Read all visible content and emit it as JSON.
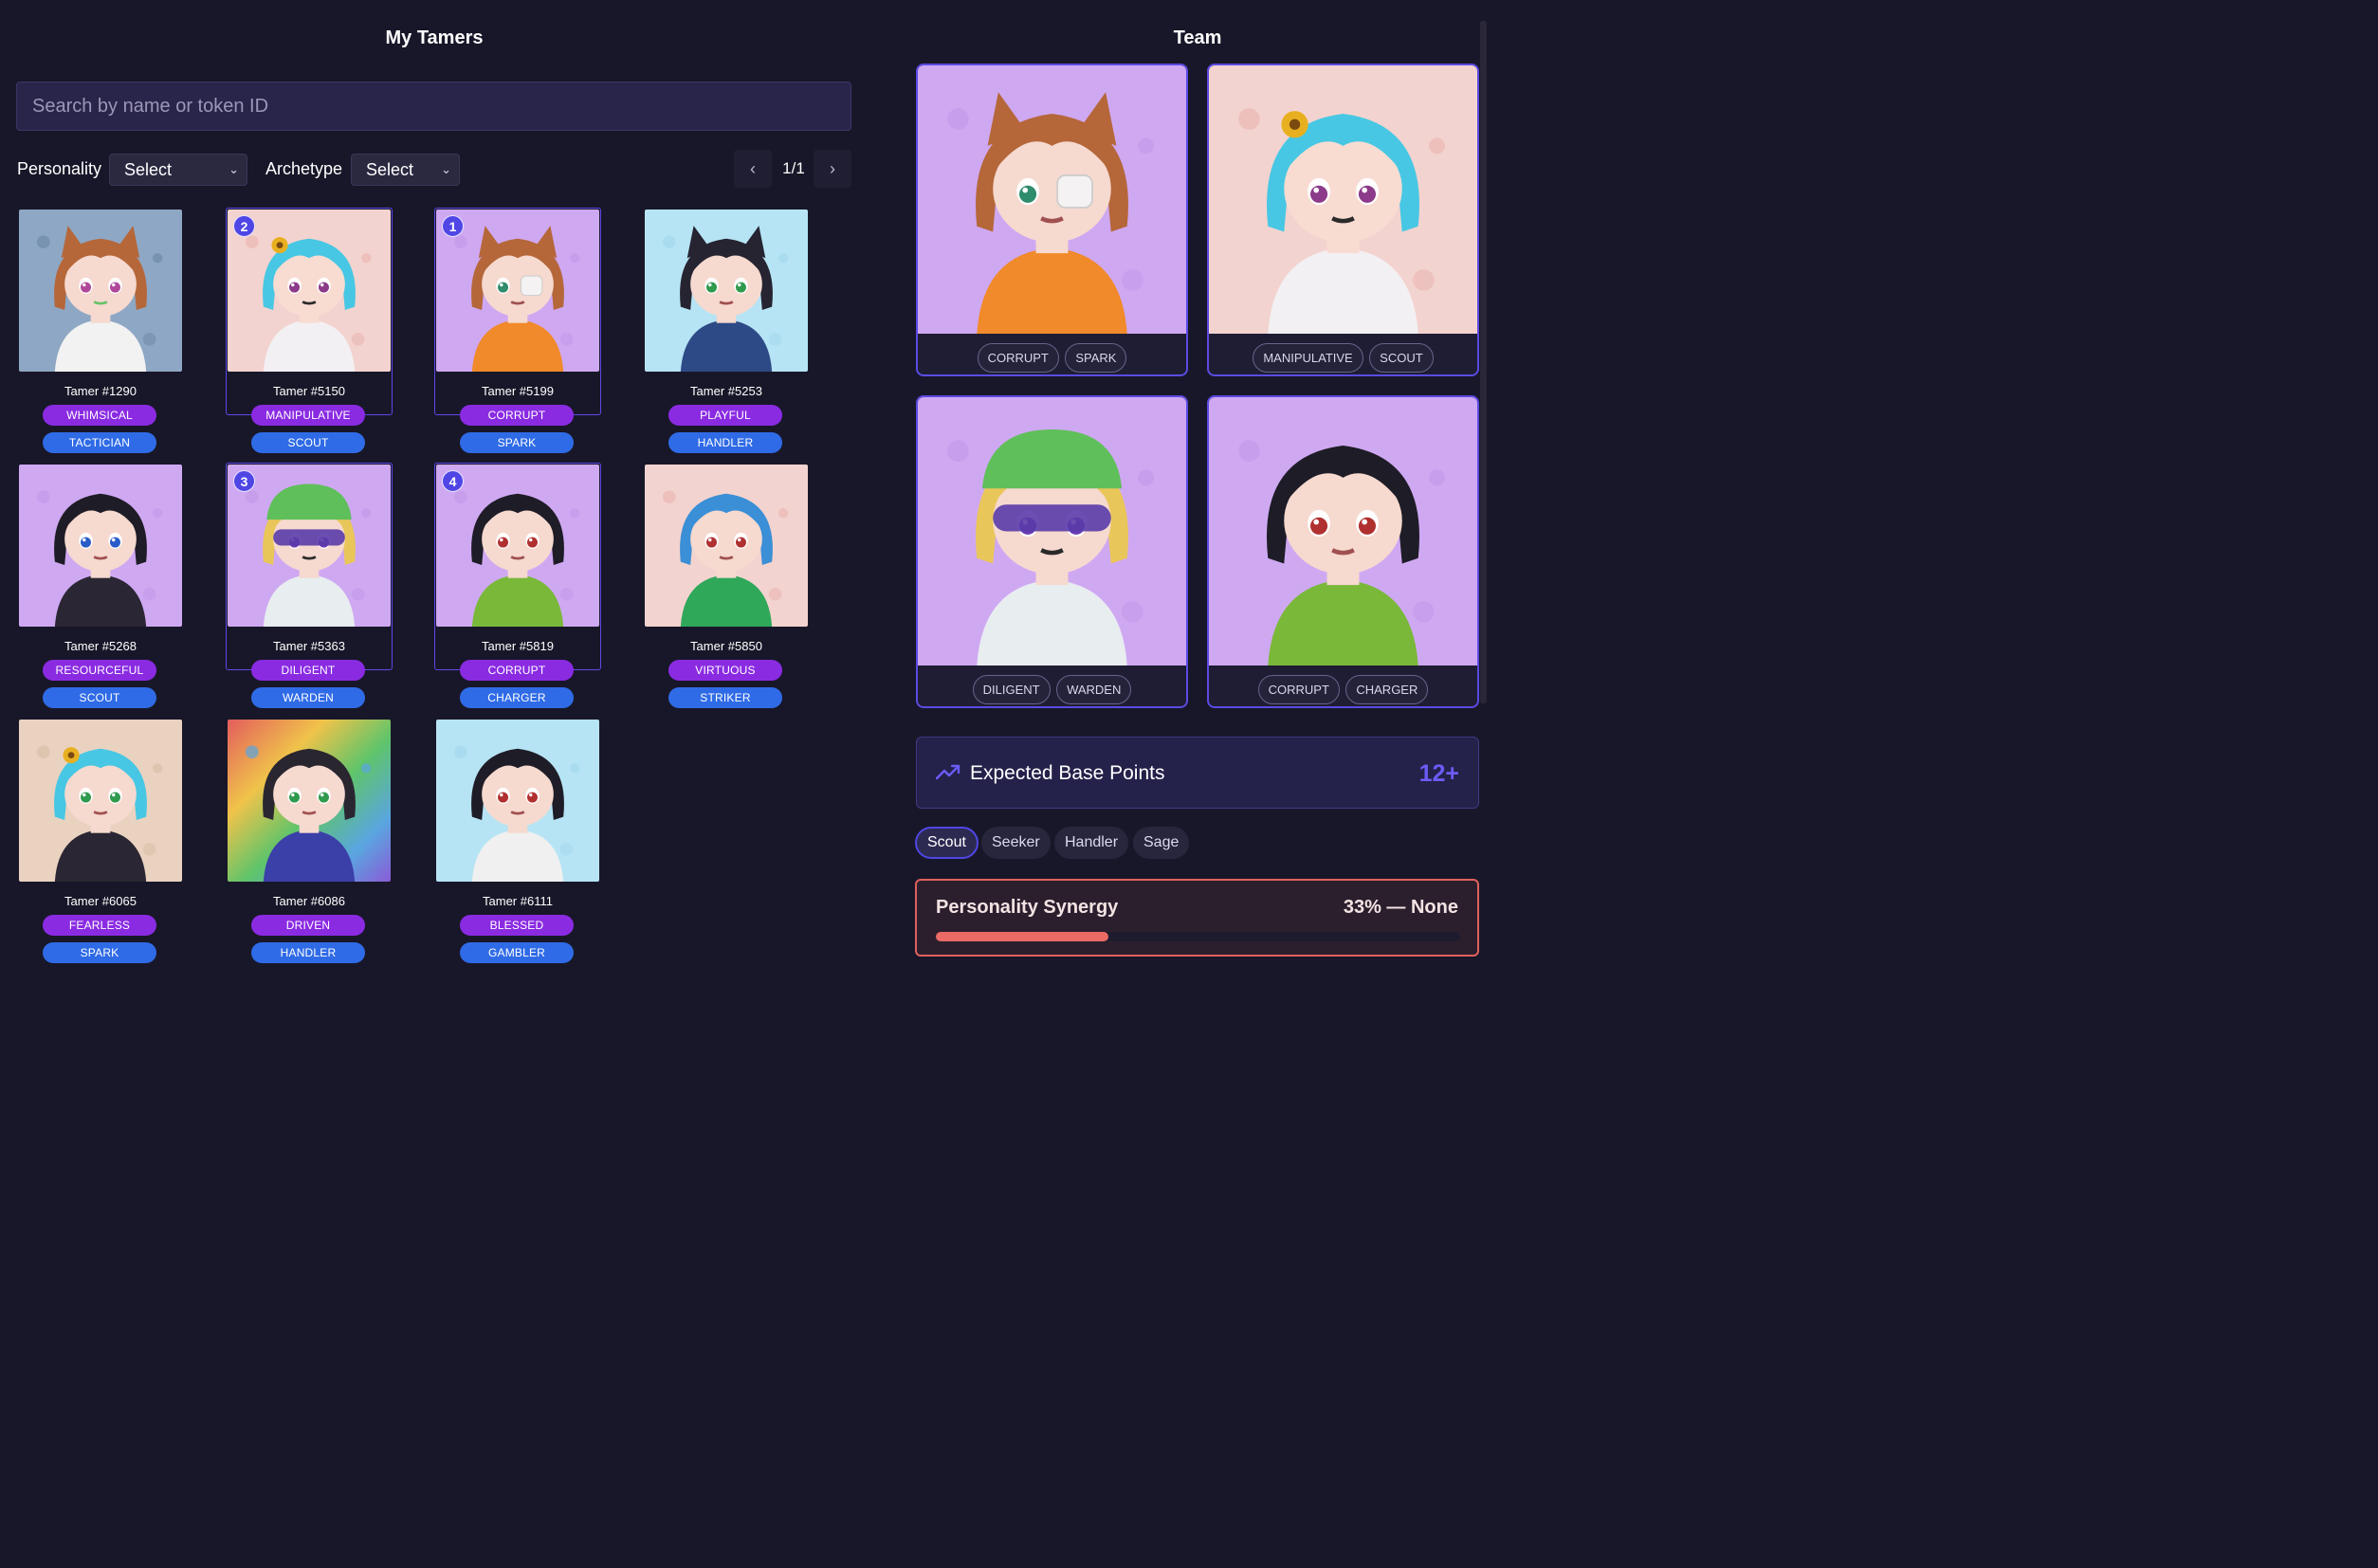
{
  "left": {
    "title": "My Tamers",
    "search_placeholder": "Search by name or token ID",
    "filters": {
      "personality_label": "Personality",
      "personality_value": "Select",
      "archetype_label": "Archetype",
      "archetype_value": "Select"
    },
    "pager": {
      "text": "1/1",
      "prev_icon": "chevron-left-icon",
      "next_icon": "chevron-right-icon"
    },
    "tamers": [
      {
        "name": "Tamer #1290",
        "personality": "WHIMSICAL",
        "archetype": "TACTICIAN",
        "rank": null
      },
      {
        "name": "Tamer #5150",
        "personality": "MANIPULATIVE",
        "archetype": "SCOUT",
        "rank": "2"
      },
      {
        "name": "Tamer #5199",
        "personality": "CORRUPT",
        "archetype": "SPARK",
        "rank": "1"
      },
      {
        "name": "Tamer #5253",
        "personality": "PLAYFUL",
        "archetype": "HANDLER",
        "rank": null
      },
      {
        "name": "Tamer #5268",
        "personality": "RESOURCEFUL",
        "archetype": "SCOUT",
        "rank": null
      },
      {
        "name": "Tamer #5363",
        "personality": "DILIGENT",
        "archetype": "WARDEN",
        "rank": "3"
      },
      {
        "name": "Tamer #5819",
        "personality": "CORRUPT",
        "archetype": "CHARGER",
        "rank": "4"
      },
      {
        "name": "Tamer #5850",
        "personality": "VIRTUOUS",
        "archetype": "STRIKER",
        "rank": null
      },
      {
        "name": "Tamer #6065",
        "personality": "FEARLESS",
        "archetype": "SPARK",
        "rank": null
      },
      {
        "name": "Tamer #6086",
        "personality": "DRIVEN",
        "archetype": "HANDLER",
        "rank": null
      },
      {
        "name": "Tamer #6111",
        "personality": "BLESSED",
        "archetype": "GAMBLER",
        "rank": null
      }
    ]
  },
  "team": {
    "title": "Team",
    "members": [
      {
        "personality": "CORRUPT",
        "archetype": "SPARK"
      },
      {
        "personality": "MANIPULATIVE",
        "archetype": "SCOUT"
      },
      {
        "personality": "DILIGENT",
        "archetype": "WARDEN"
      },
      {
        "personality": "CORRUPT",
        "archetype": "CHARGER"
      }
    ],
    "expected_points": {
      "label": "Expected Base Points",
      "value": "12+",
      "icon": "trending-up-icon",
      "accent": "#6b5cf6"
    },
    "tabs": [
      {
        "label": "Scout",
        "active": true
      },
      {
        "label": "Seeker",
        "active": false
      },
      {
        "label": "Handler",
        "active": false
      },
      {
        "label": "Sage",
        "active": false
      }
    ],
    "synergy": {
      "label": "Personality Synergy",
      "value_text": "33% — None",
      "percent": 33,
      "accent": "#ec6a65"
    }
  },
  "colors": {
    "background": "#181729",
    "personality_pill": "#8a2be2",
    "archetype_pill": "#2f6be6",
    "selection_border": "#5b48e8"
  }
}
